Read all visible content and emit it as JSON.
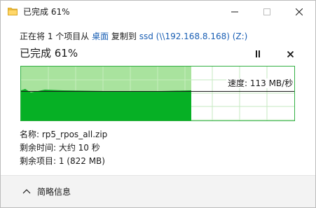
{
  "window": {
    "title": "已完成 61%"
  },
  "operation": {
    "prefix": "正在将 1 个项目从 ",
    "source": "桌面",
    "middle": " 复制到 ",
    "destination": "ssd (\\\\192.168.8.168) (Z:)"
  },
  "progress": {
    "label": "已完成 61%",
    "percent": 61
  },
  "speed": {
    "label": "速度: 113 MB/秒"
  },
  "details": {
    "name": "名称: rp5_rpos_all.zip",
    "time_remaining": "剩余时间: 大约 10 秒",
    "items_remaining": "剩余项目: 1 (822 MB)"
  },
  "footer": {
    "toggle_label": "简略信息"
  },
  "colors": {
    "progress_fill": "#a9e39e",
    "speed_fill": "#06b025",
    "grid": "#c5e8c1",
    "link": "#1a5fb4"
  }
}
